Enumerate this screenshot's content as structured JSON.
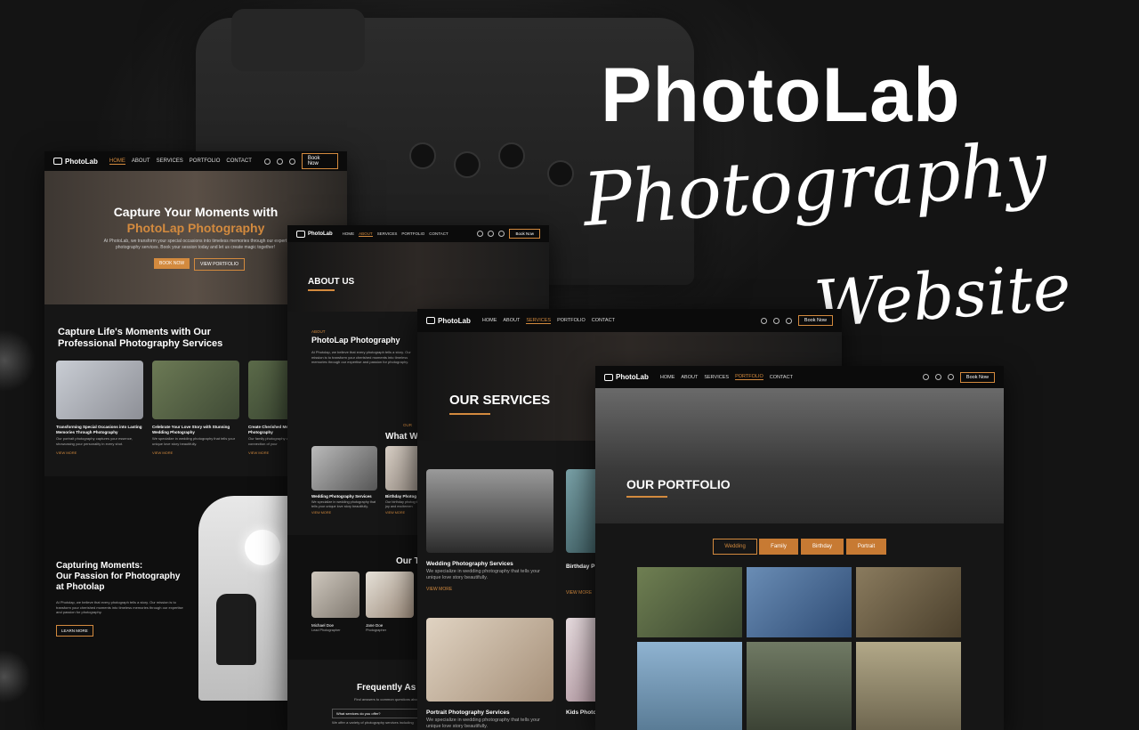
{
  "headline": {
    "title": "PhotoLab",
    "script_line1": "Photography",
    "script_line2": "Website"
  },
  "nav": {
    "logo": "PhotoLab",
    "items": [
      "HOME",
      "ABOUT",
      "SERVICES",
      "PORTFOLIO",
      "CONTACT"
    ],
    "book": "Book Now"
  },
  "home": {
    "hero_line1": "Capture Your Moments with",
    "hero_line2": "PhotoLap Photography",
    "hero_text": "At PhotoLab, we transform your special occasions into timeless memories through our expert photography services. Book your session today and let us create magic together!",
    "btn_book": "BOOK NOW",
    "btn_portfolio": "VIEW PORTFOLIO",
    "section_title_1": "Capture Life's Moments with Our",
    "section_title_2": "Professional Photography Services",
    "cards": [
      {
        "title": "Transforming Special Occasions into Lasting Memories Through Photography",
        "text": "Our portrait photography captures your essence, showcasing your personality in every shot.",
        "link": "VIEW MORE"
      },
      {
        "title": "Celebrate Your Love Story with Stunning Wedding Photography",
        "text": "We specialize in wedding photography that tells your unique love story beautifully.",
        "link": "VIEW MORE"
      },
      {
        "title": "Create Cherished Memories with Our Family Photography",
        "text": "Our family photography captures the love and connection of your",
        "link": "VIEW MORE"
      }
    ],
    "passion_1": "Capturing Moments:",
    "passion_2": "Our Passion for Photography",
    "passion_3": "at Photolap",
    "passion_text": "At Photolap, we believe that every photograph tells a story. Our mission is to transform your cherished moments into timeless memories through our expertise and passion for photography.",
    "learn_more": "LEARN MORE"
  },
  "about": {
    "banner": "ABOUT US",
    "kicker": "ABOUT",
    "title": "PhotoLap Photography",
    "text": "At Photolap, we believe that every photograph tells a story. Our mission is to transform your cherished moments into timeless memories through our expertise and passion for photography.",
    "what_heading": "What W",
    "what_kicker": "OUR",
    "card1_title": "Wedding Photography Services",
    "card1_text": "We specialize in wedding photography that tells your unique love story beautifully.",
    "card2_title": "Birthday Photog",
    "card2_text": "Our birthday photog the joy and excitemen",
    "team_heading": "Our T",
    "member1_name": "Michael Doe",
    "member1_role": "Lead Photographer",
    "member2_name": "Jane Doe",
    "member2_role": "Photographer",
    "faq_heading": "Frequently As",
    "faq_sub": "Find answers to common questions about",
    "faq_q": "What services do you offer?",
    "faq_a": "We offer a variety of photography services including",
    "view_more": "VIEW MORE"
  },
  "services": {
    "banner": "OUR SERVICES",
    "card1_title": "Wedding Photography Services",
    "card1_text": "We specialize in wedding photography that tells your unique love story beautifully.",
    "card1_link": "VIEW MORE",
    "card2_title": "Birthday P",
    "card2_link": "VIEW MORE",
    "card3_title": "Portrait Photography Services",
    "card3_text": "We specialize in wedding photography that tells your unique love story beautifully.",
    "card4_title": "Kids Photo"
  },
  "portfolio": {
    "banner": "OUR PORTFOLIO",
    "filters": [
      "Wedding",
      "Family",
      "Birthday",
      "Portrait"
    ]
  },
  "colors": {
    "accent": "#d38a3e",
    "bg": "#161616",
    "nav": "#0b0b0b"
  }
}
